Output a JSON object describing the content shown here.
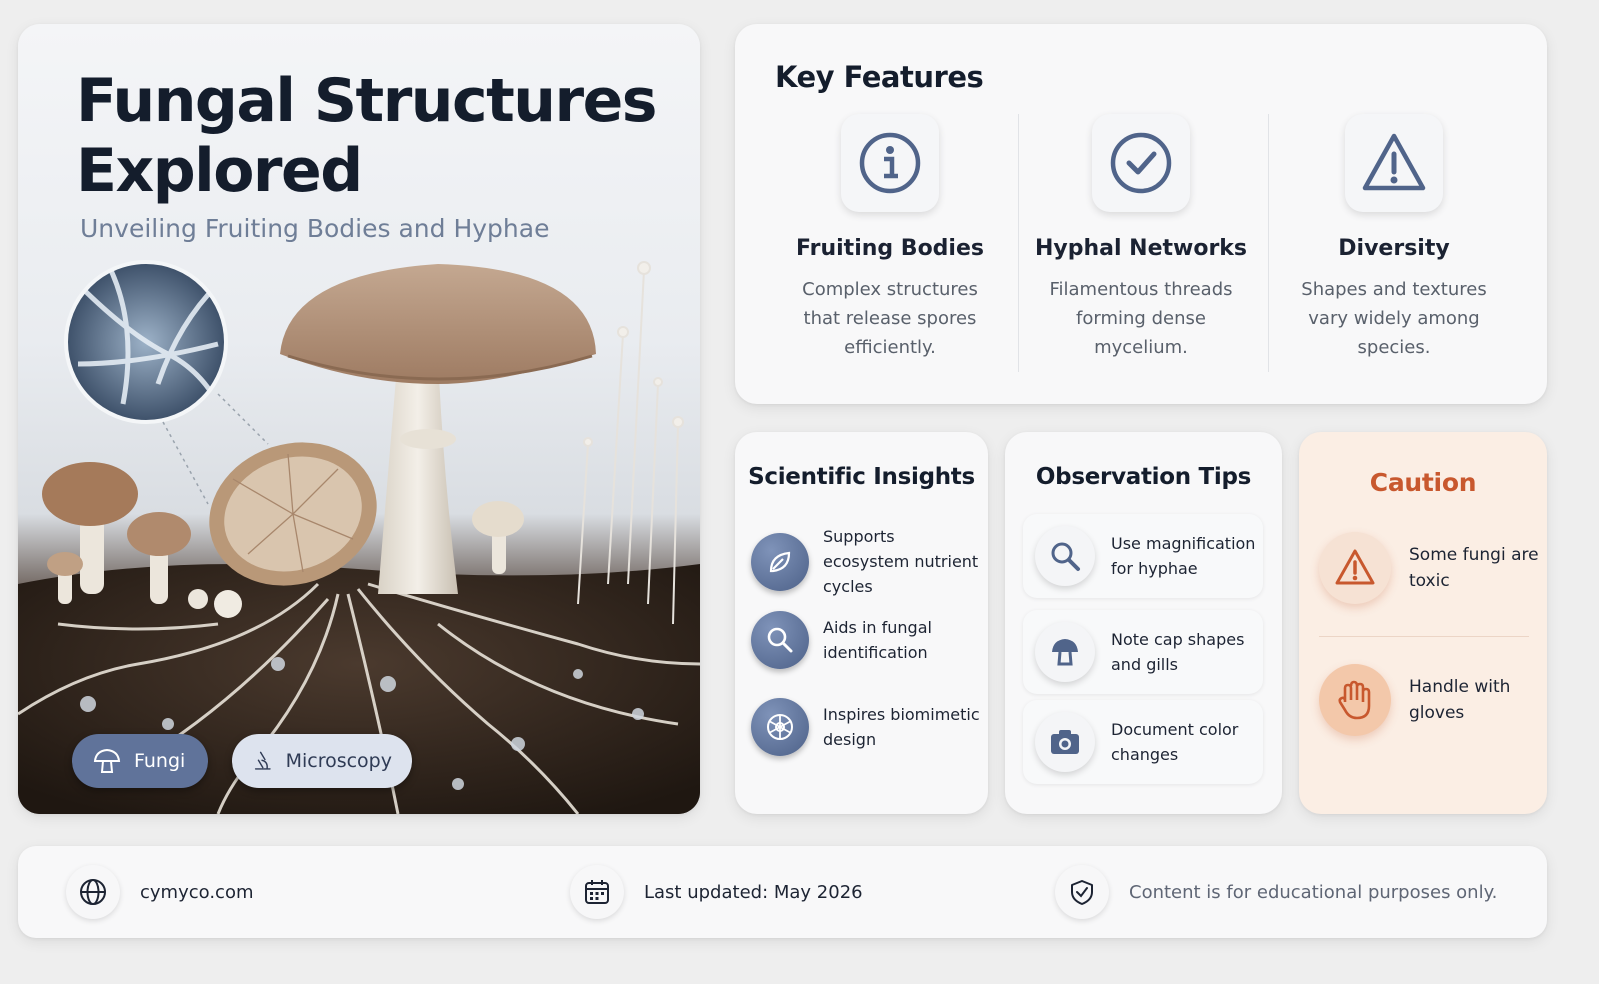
{
  "hero": {
    "title": "Fungal Structures Explored",
    "subtitle": "Unveiling Fruiting Bodies and Hyphae",
    "tags": [
      {
        "label": "Fungi",
        "icon": "mushroom-icon"
      },
      {
        "label": "Microscopy",
        "icon": "microscope-icon"
      }
    ]
  },
  "key_features": {
    "title": "Key Features",
    "items": [
      {
        "icon": "info-icon",
        "title": "Fruiting Bodies",
        "text": "Complex structures that release spores efficiently."
      },
      {
        "icon": "check-circle-icon",
        "title": "Hyphal Networks",
        "text": "Filamentous threads forming dense mycelium."
      },
      {
        "icon": "warning-icon",
        "title": "Diversity",
        "text": "Shapes and textures vary widely among species."
      }
    ]
  },
  "scientific_insights": {
    "title": "Scientific Insights",
    "items": [
      {
        "icon": "leaf-icon",
        "text": "Supports ecosystem nutrient cycles"
      },
      {
        "icon": "search-icon",
        "text": "Aids in fungal identification"
      },
      {
        "icon": "network-icon",
        "text": "Inspires biomimetic design"
      }
    ]
  },
  "observation_tips": {
    "title": "Observation Tips",
    "items": [
      {
        "icon": "magnifier-icon",
        "text": "Use magnification for hyphae"
      },
      {
        "icon": "mushroom-icon",
        "text": "Note cap shapes and gills"
      },
      {
        "icon": "camera-icon",
        "text": "Document color changes"
      }
    ]
  },
  "caution": {
    "title": "Caution",
    "items": [
      {
        "icon": "warning-icon",
        "text": "Some fungi are toxic"
      },
      {
        "icon": "hand-icon",
        "text": "Handle with gloves"
      }
    ]
  },
  "footer": {
    "website": "cymyco.com",
    "updated": "Last updated: May 2026",
    "disclaimer": "Content is for educational purposes only."
  },
  "colors": {
    "title": "#141d2c",
    "subtitle": "#6f7e97",
    "accent_blue": "#60739a",
    "caution": "#c8582e",
    "caution_bg": "#fbeee4"
  }
}
